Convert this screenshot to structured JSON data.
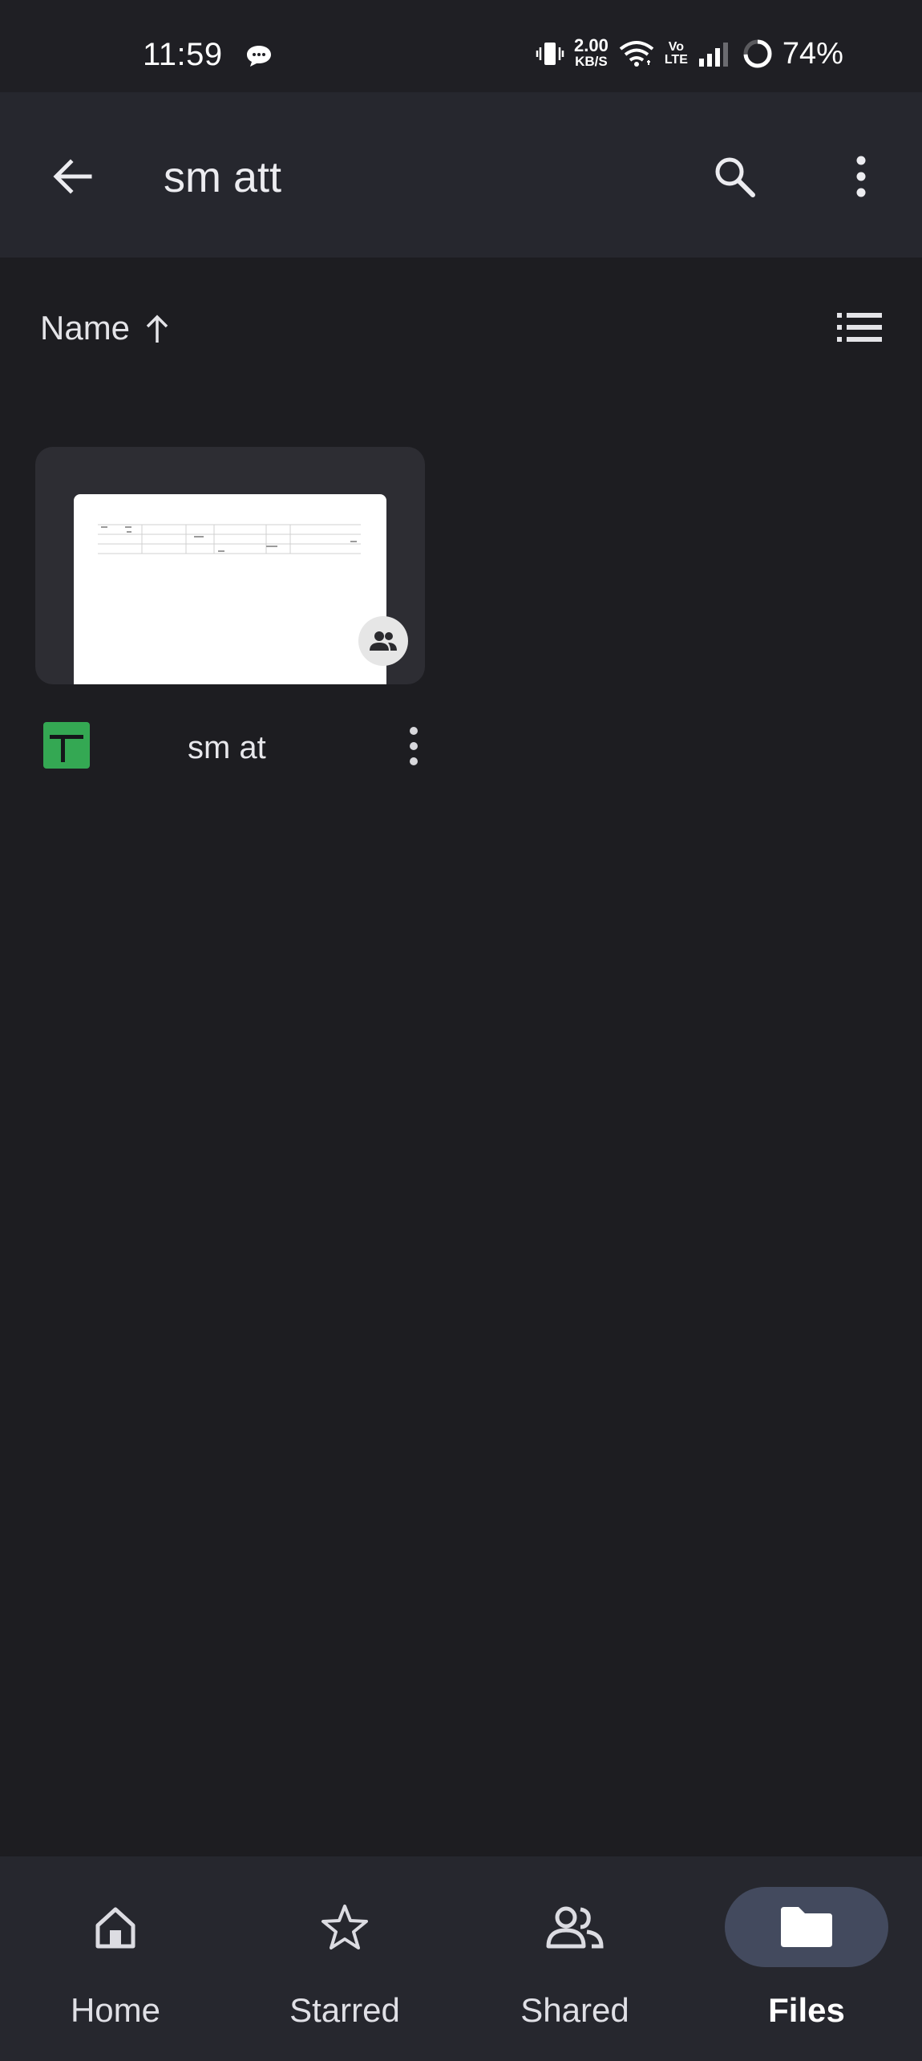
{
  "status_bar": {
    "time": "11:59",
    "net_speed_value": "2.00",
    "net_speed_unit": "KB/S",
    "volte_top": "Vo",
    "volte_bottom": "LTE",
    "battery_percent": "74%",
    "icons": [
      "chat-notification-icon",
      "vibrate-icon",
      "wifi-icon",
      "volte-icon",
      "signal-icon",
      "battery-ring-icon"
    ]
  },
  "app_bar": {
    "title": "sm att",
    "icons": [
      "back-arrow-icon",
      "search-icon",
      "more-vert-icon"
    ]
  },
  "sort": {
    "label": "Name",
    "direction_icon": "arrow-up-icon",
    "view_toggle_icon": "list-view-icon"
  },
  "files": [
    {
      "name": "sm at",
      "type_icon": "google-sheets-icon",
      "shared_icon": "people-icon",
      "menu_icon": "more-vert-icon"
    }
  ],
  "bottom_nav": {
    "items": [
      {
        "label": "Home",
        "icon": "home-icon",
        "active": false
      },
      {
        "label": "Starred",
        "icon": "star-icon",
        "active": false
      },
      {
        "label": "Shared",
        "icon": "people-icon",
        "active": false
      },
      {
        "label": "Files",
        "icon": "folder-icon",
        "active": true
      }
    ]
  },
  "colors": {
    "background": "#1d1d21",
    "app_bar": "#26272e",
    "card": "#2d2d33",
    "active_pill": "#434a5e",
    "sheets_green": "#34a853"
  }
}
